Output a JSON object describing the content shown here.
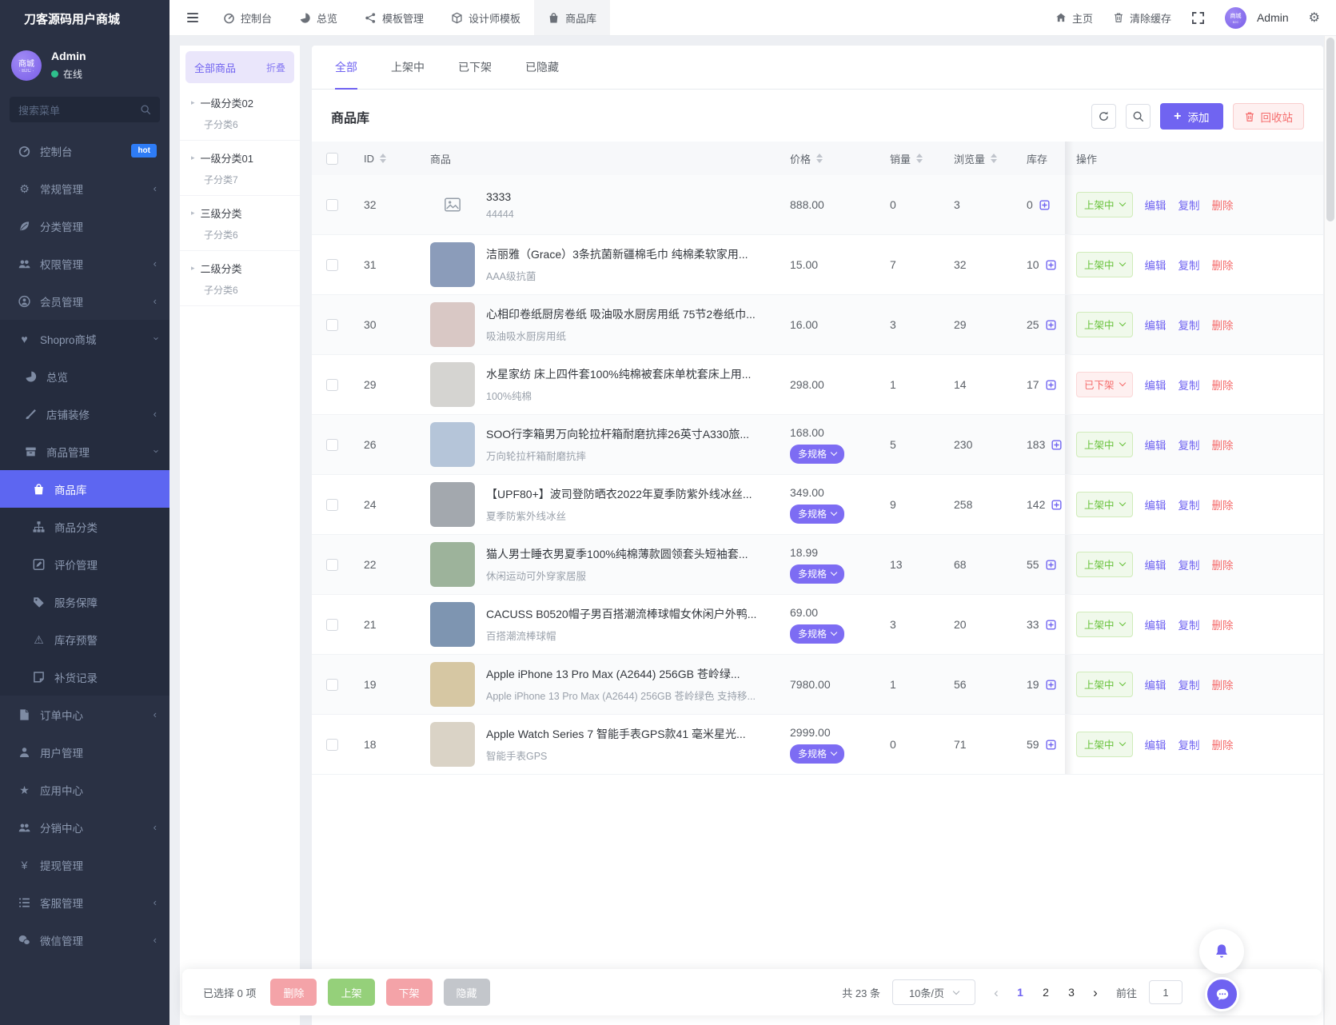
{
  "app": {
    "title": "刀客源码用户商城"
  },
  "sidebar": {
    "user": {
      "name": "Admin",
      "status": "在线",
      "avatar_text": "商城",
      "avatar_sub": "· B2C ·"
    },
    "search_placeholder": "搜索菜单",
    "items": [
      {
        "label": "控制台",
        "icon": "gauge",
        "badge": "hot"
      },
      {
        "label": "常规管理",
        "icon": "gears",
        "arrow": "left"
      },
      {
        "label": "分类管理",
        "icon": "leaf"
      },
      {
        "label": "权限管理",
        "icon": "team",
        "arrow": "left"
      },
      {
        "label": "会员管理",
        "icon": "member",
        "arrow": "left"
      },
      {
        "label": "Shopro商城",
        "icon": "shop",
        "arrow": "down",
        "section": true
      },
      {
        "label": "总览",
        "icon": "pie",
        "indent": 1,
        "section": true
      },
      {
        "label": "店铺装修",
        "icon": "brush",
        "arrow": "left",
        "indent": 1,
        "section": true
      },
      {
        "label": "商品管理",
        "icon": "goods",
        "arrow": "down",
        "indent": 1,
        "section": true
      },
      {
        "label": "商品库",
        "icon": "bag",
        "indent": 2,
        "active": true,
        "section": true
      },
      {
        "label": "商品分类",
        "icon": "sitemap",
        "indent": 2,
        "section": true
      },
      {
        "label": "评价管理",
        "icon": "review",
        "indent": 2,
        "section": true
      },
      {
        "label": "服务保障",
        "icon": "tag",
        "indent": 2,
        "section": true
      },
      {
        "label": "库存预警",
        "icon": "warning",
        "indent": 2,
        "section": true
      },
      {
        "label": "补货记录",
        "icon": "note",
        "indent": 2,
        "section": true
      },
      {
        "label": "订单中心",
        "icon": "order",
        "arrow": "left"
      },
      {
        "label": "用户管理",
        "icon": "user"
      },
      {
        "label": "应用中心",
        "icon": "star"
      },
      {
        "label": "分销中心",
        "icon": "team",
        "arrow": "left"
      },
      {
        "label": "提现管理",
        "icon": "yen"
      },
      {
        "label": "客服管理",
        "icon": "service",
        "arrow": "left"
      },
      {
        "label": "微信管理",
        "icon": "wechat",
        "arrow": "left"
      }
    ]
  },
  "topnav": {
    "tabs": [
      {
        "label": "控制台",
        "icon": "gauge"
      },
      {
        "label": "总览",
        "icon": "pie"
      },
      {
        "label": "模板管理",
        "icon": "share"
      },
      {
        "label": "设计师模板",
        "icon": "cube"
      },
      {
        "label": "商品库",
        "icon": "bag",
        "active": true
      }
    ],
    "home": "主页",
    "clear_cache": "清除缓存",
    "username": "Admin"
  },
  "category": {
    "header": "全部商品",
    "collapse_label": "折叠",
    "items": [
      {
        "name": "一级分类02",
        "sub": "子分类6"
      },
      {
        "name": "一级分类01",
        "sub": "子分类7"
      },
      {
        "name": "三级分类",
        "sub": "子分类6"
      },
      {
        "name": "二级分类",
        "sub": "子分类6"
      }
    ]
  },
  "main": {
    "tabs": [
      {
        "label": "全部",
        "active": true
      },
      {
        "label": "上架中"
      },
      {
        "label": "已下架"
      },
      {
        "label": "已隐藏"
      }
    ],
    "title": "商品库",
    "toolbar": {
      "add": "添加",
      "recycle": "回收站"
    },
    "table": {
      "headers": {
        "id": "ID",
        "product": "商品",
        "price": "价格",
        "sales": "销量",
        "views": "浏览量",
        "stock": "库存",
        "ops": "操作"
      },
      "multi_label": "多规格",
      "actions": {
        "edit": "编辑",
        "copy": "复制",
        "delete": "删除"
      },
      "rows": [
        {
          "id": "32",
          "no_image": true,
          "title": "3333",
          "subtitle": "44444",
          "price": "888.00",
          "sales": "0",
          "views": "3",
          "stock": "0",
          "status": "上架中",
          "status_type": "on"
        },
        {
          "id": "31",
          "thumb_color": "#8b9cba",
          "title": "洁丽雅（Grace）3条抗菌新疆棉毛巾 纯棉柔软家用...",
          "subtitle": "AAA级抗菌",
          "price": "15.00",
          "sales": "7",
          "views": "32",
          "stock": "10",
          "status": "上架中",
          "status_type": "on"
        },
        {
          "id": "30",
          "thumb_color": "#d9c8c5",
          "title": "心相印卷纸厨房卷纸 吸油吸水厨房用纸 75节2卷纸巾...",
          "subtitle": "吸油吸水厨房用纸",
          "price": "16.00",
          "sales": "3",
          "views": "29",
          "stock": "25",
          "status": "上架中",
          "status_type": "on"
        },
        {
          "id": "29",
          "thumb_color": "#d5d4d1",
          "title": "水星家纺 床上四件套100%纯棉被套床单枕套床上用...",
          "subtitle": "100%纯棉",
          "price": "298.00",
          "sales": "1",
          "views": "14",
          "stock": "17",
          "status": "已下架",
          "status_type": "off"
        },
        {
          "id": "26",
          "thumb_color": "#b5c5d9",
          "title": "SOO行李箱男万向轮拉杆箱耐磨抗摔26英寸A330旅...",
          "subtitle": "万向轮拉杆箱耐磨抗摔",
          "price": "168.00",
          "multi": true,
          "sales": "5",
          "views": "230",
          "stock": "183",
          "status": "上架中",
          "status_type": "on"
        },
        {
          "id": "24",
          "thumb_color": "#a3a8ae",
          "title": "【UPF80+】波司登防晒衣2022年夏季防紫外线冰丝...",
          "subtitle": "夏季防紫外线冰丝",
          "price": "349.00",
          "multi": true,
          "sales": "9",
          "views": "258",
          "stock": "142",
          "status": "上架中",
          "status_type": "on"
        },
        {
          "id": "22",
          "thumb_color": "#9db39b",
          "title": "猫人男士睡衣男夏季100%纯棉薄款圆领套头短袖套...",
          "subtitle": "休闲运动可外穿家居服",
          "price": "18.99",
          "multi": true,
          "sales": "13",
          "views": "68",
          "stock": "55",
          "status": "上架中",
          "status_type": "on"
        },
        {
          "id": "21",
          "thumb_color": "#7e95b1",
          "title": "CACUSS B0520帽子男百搭潮流棒球帽女休闲户外鸭...",
          "subtitle": "百搭潮流棒球帽",
          "price": "69.00",
          "multi": true,
          "sales": "3",
          "views": "20",
          "stock": "33",
          "status": "上架中",
          "status_type": "on"
        },
        {
          "id": "19",
          "thumb_color": "#d6c7a3",
          "title": "Apple iPhone 13 Pro Max (A2644) 256GB 苍岭绿...",
          "subtitle": "Apple iPhone 13 Pro Max (A2644) 256GB 苍岭绿色 支持移...",
          "price": "7980.00",
          "sales": "1",
          "views": "56",
          "stock": "19",
          "status": "上架中",
          "status_type": "on"
        },
        {
          "id": "18",
          "thumb_color": "#dad3c6",
          "title": "Apple Watch Series 7 智能手表GPS款41 毫米星光...",
          "subtitle": "智能手表GPS",
          "price": "2999.00",
          "multi": true,
          "sales": "0",
          "views": "71",
          "stock": "59",
          "status": "上架中",
          "status_type": "on"
        }
      ]
    },
    "footer": {
      "selected_text": "已选择 0 项",
      "actions": [
        {
          "label": "删除",
          "color": "#f4a3a8"
        },
        {
          "label": "上架",
          "color": "#95d07a"
        },
        {
          "label": "下架",
          "color": "#f4a3a8"
        },
        {
          "label": "隐藏",
          "color": "#c3c6cb"
        }
      ],
      "total": "共 23 条",
      "page_size": "10条/页",
      "pages": [
        {
          "label": "1",
          "active": true
        },
        {
          "label": "2"
        },
        {
          "label": "3"
        }
      ],
      "goto_label": "前往",
      "goto_value": "1"
    }
  },
  "theme": {
    "primary": "#6f62f1",
    "danger": "#f56c6c",
    "success": "#67c23a",
    "sidebar_bg": "#2a3144"
  }
}
